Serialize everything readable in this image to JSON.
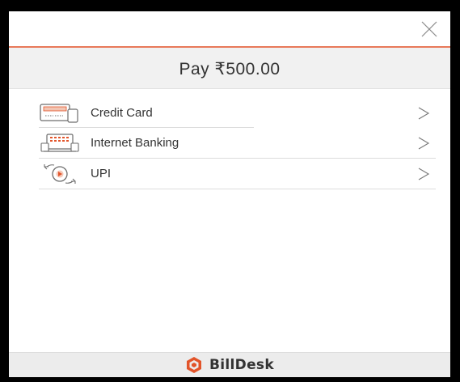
{
  "payment": {
    "amount_label": "Pay ₹500.00"
  },
  "methods": [
    {
      "label": "Credit Card",
      "icon": "credit-card-icon"
    },
    {
      "label": "Internet Banking",
      "icon": "internet-banking-icon"
    },
    {
      "label": "UPI",
      "icon": "upi-icon"
    }
  ],
  "footer": {
    "brand_name": "BillDesk"
  },
  "colors": {
    "accent": "#e8795a",
    "brand_orange": "#e2542a",
    "text": "#333333",
    "header_bg": "#f1f1f1",
    "footer_bg": "#ececec"
  }
}
